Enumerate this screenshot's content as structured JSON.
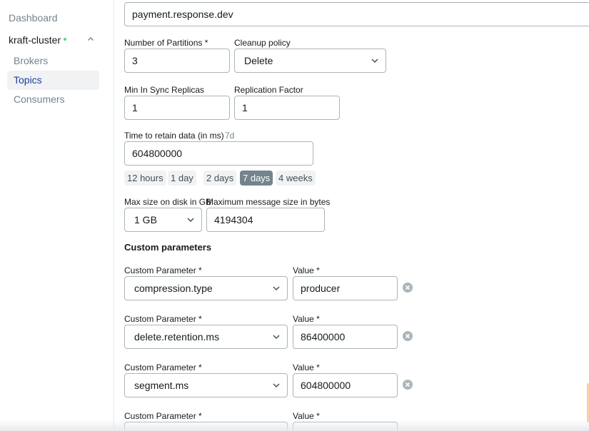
{
  "sidebar": {
    "dashboard": "Dashboard",
    "cluster_name": "kraft-cluster",
    "items": [
      {
        "label": "Brokers"
      },
      {
        "label": "Topics"
      },
      {
        "label": "Consumers"
      }
    ],
    "active_item": "Topics",
    "status_color": "#5cd685"
  },
  "form": {
    "topic_name": "payment.response.dev",
    "partitions": {
      "label": "Number of Partitions *",
      "value": "3"
    },
    "cleanup": {
      "label": "Cleanup policy",
      "value": "Delete"
    },
    "min_isr": {
      "label": "Min In Sync Replicas",
      "value": "1"
    },
    "replication": {
      "label": "Replication Factor",
      "value": "1"
    },
    "retention": {
      "label": "Time to retain data (in ms)",
      "hint": "7d",
      "value": "604800000"
    },
    "retention_presets": [
      {
        "label": "12 hours"
      },
      {
        "label": "1 day"
      },
      {
        "label": "2 days"
      },
      {
        "label": "7 days"
      },
      {
        "label": "4 weeks"
      }
    ],
    "retention_selected": "7 days",
    "max_disk": {
      "label": "Max size on disk in GB",
      "value": "1 GB"
    },
    "max_message": {
      "label": "Maximum message size in bytes",
      "value": "4194304"
    },
    "custom_title": "Custom parameters",
    "custom_params": [
      {
        "param_label": "Custom Parameter *",
        "param": "compression.type",
        "value_label": "Value *",
        "value": "producer"
      },
      {
        "param_label": "Custom Parameter *",
        "param": "delete.retention.ms",
        "value_label": "Value *",
        "value": "86400000"
      },
      {
        "param_label": "Custom Parameter *",
        "param": "segment.ms",
        "value_label": "Value *",
        "value": "604800000"
      },
      {
        "param_label": "Custom Parameter *",
        "param": "",
        "value_label": "Value *",
        "value": ""
      }
    ]
  },
  "colors": {
    "accent": "#1c3ea0",
    "chip_active": "#73848c",
    "border": "#abb5ba"
  }
}
